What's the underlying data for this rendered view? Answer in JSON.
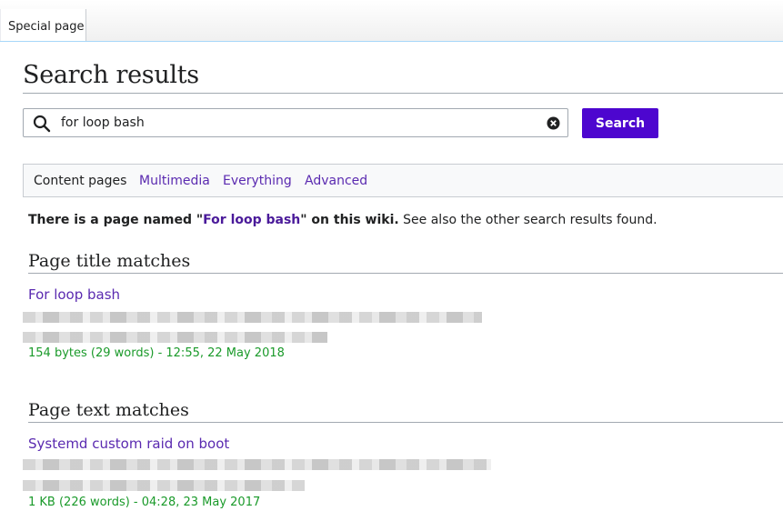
{
  "tab": {
    "label": "Special page"
  },
  "page": {
    "title": "Search results"
  },
  "search": {
    "value": "for loop bash",
    "button_label": "Search"
  },
  "profiles": [
    {
      "label": "Content pages",
      "active": true
    },
    {
      "label": "Multimedia",
      "active": false
    },
    {
      "label": "Everything",
      "active": false
    },
    {
      "label": "Advanced",
      "active": false
    }
  ],
  "info": {
    "prefix": "There is a page named \"",
    "page_link": "For loop bash",
    "suffix": "\" on this wiki.",
    "rest": " See also the other search results found."
  },
  "sections": {
    "title_matches": {
      "heading": "Page title matches",
      "result_title": "For loop bash",
      "meta": "154 bytes (29 words) - 12:55, 22 May 2018"
    },
    "text_matches": {
      "heading": "Page text matches",
      "result_title": "Systemd custom raid on boot",
      "meta": "1 KB (226 words) - 04:28, 23 May 2017"
    }
  },
  "colors": {
    "accent": "#4d06cf",
    "link": "#5a2ab0",
    "meta": "#1a9a2a"
  }
}
